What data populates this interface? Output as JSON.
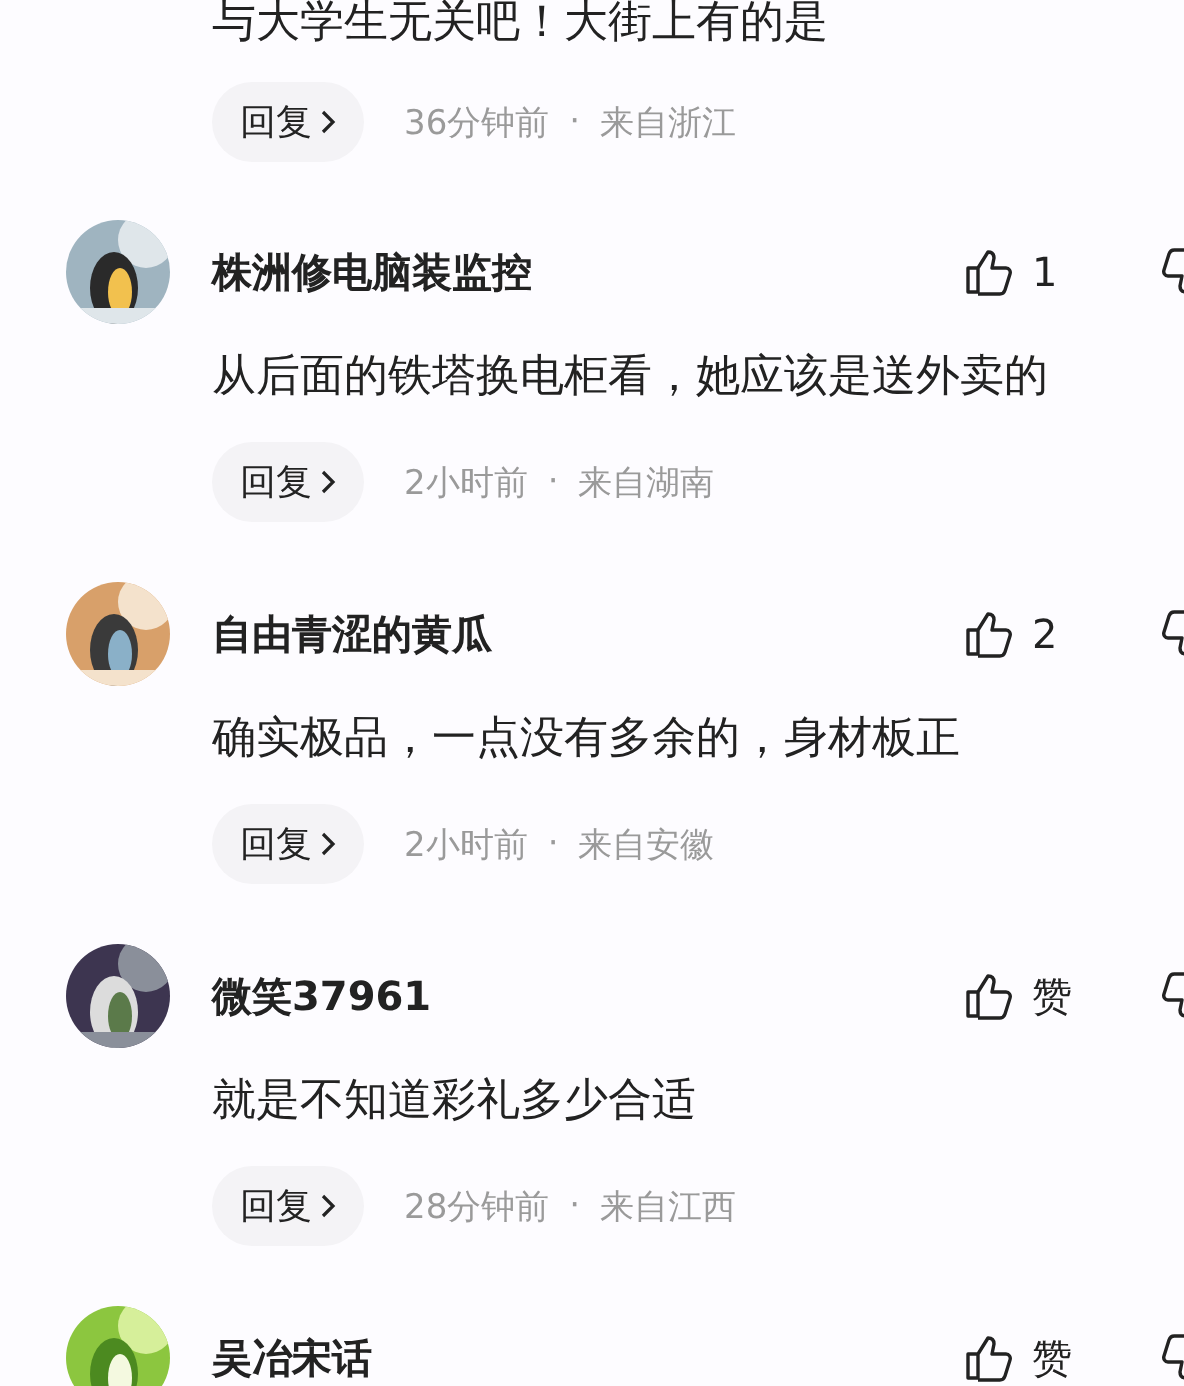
{
  "comments": [
    {
      "text": "与大学生无关吧！大街上有的是",
      "reply": "回复",
      "time": "36分钟前",
      "separator": "·",
      "location": "来自浙江"
    },
    {
      "user": "株洲修电脑装监控",
      "likes": "1",
      "text": "从后面的铁塔换电柜看，她应该是送外卖的",
      "reply": "回复",
      "time": "2小时前",
      "separator": "·",
      "location": "来自湖南"
    },
    {
      "user": "自由青涩的黄瓜",
      "likes": "2",
      "text": "确实极品，一点没有多余的，身材板正",
      "reply": "回复",
      "time": "2小时前",
      "separator": "·",
      "location": "来自安徽"
    },
    {
      "user": "微笑37961",
      "likes": "赞",
      "text": "就是不知道彩礼多少合适",
      "reply": "回复",
      "time": "28分钟前",
      "separator": "·",
      "location": "来自江西"
    },
    {
      "user": "吴冶宋话",
      "likes": "赞"
    }
  ]
}
